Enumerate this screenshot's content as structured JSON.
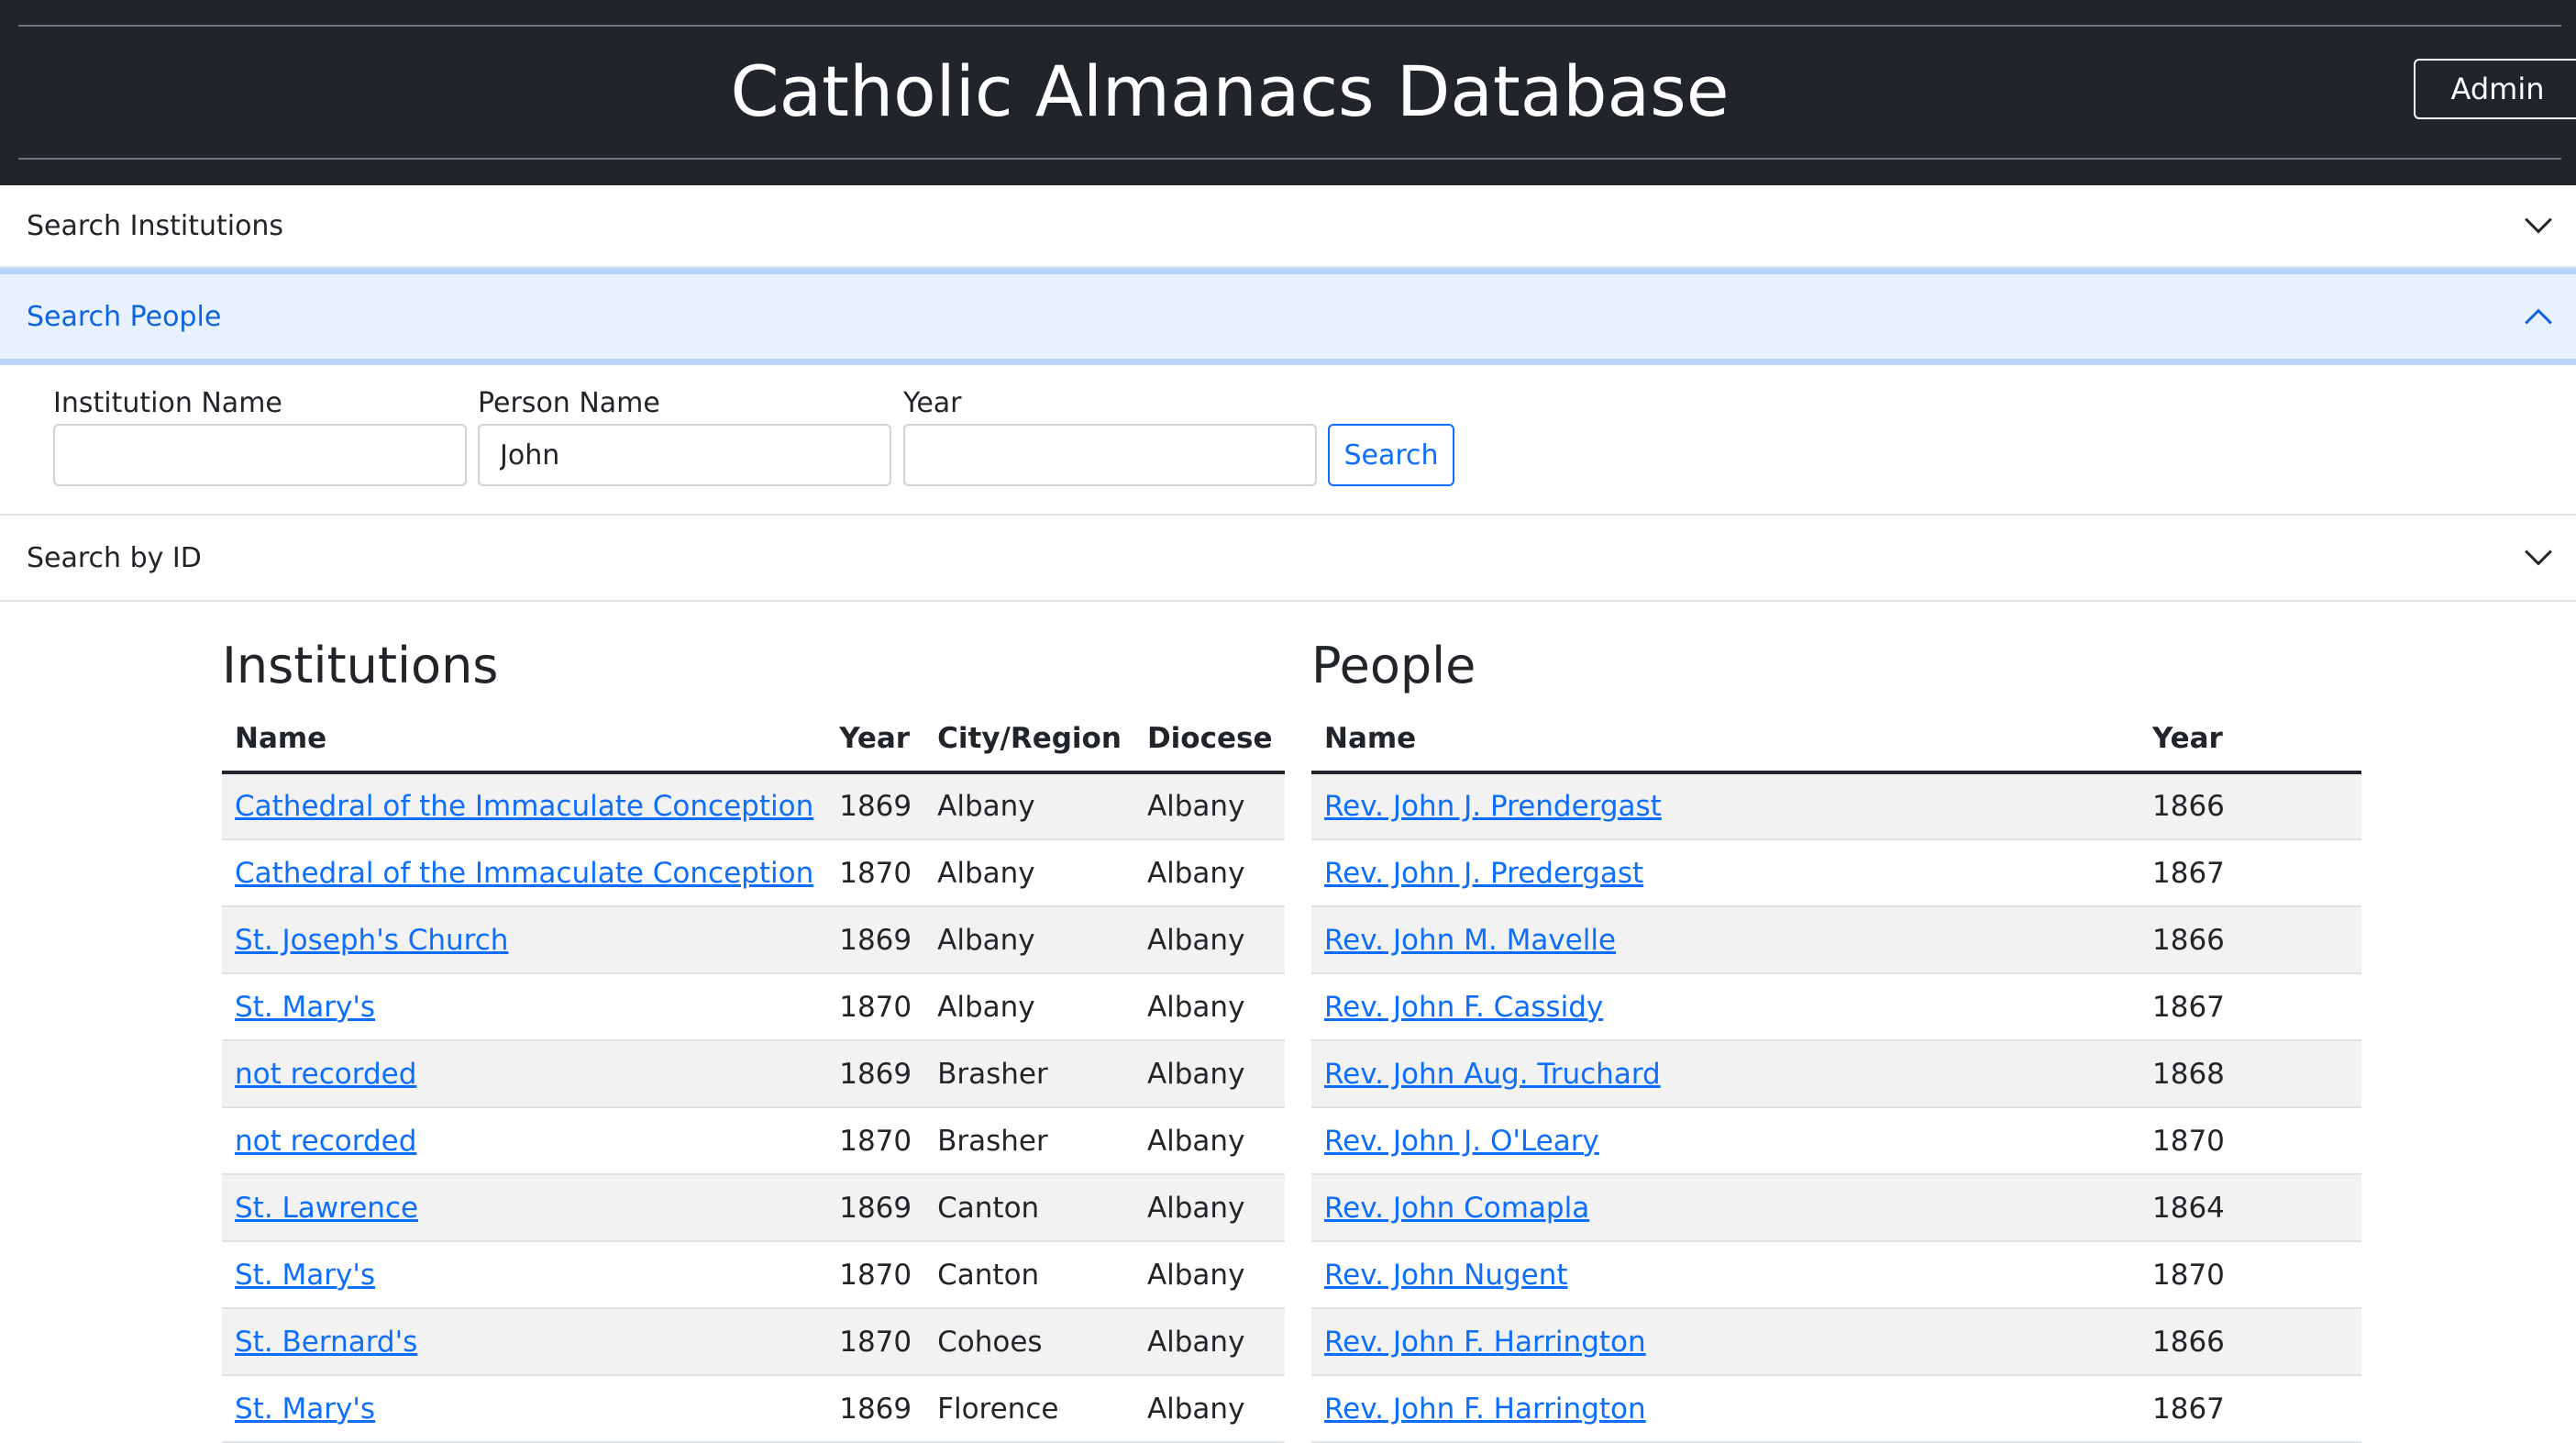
{
  "header": {
    "title": "Catholic Almanacs Database",
    "admin_label": "Admin"
  },
  "accordion": {
    "institutions_label": "Search Institutions",
    "people_label": "Search People",
    "id_label": "Search by ID"
  },
  "people_form": {
    "institution_label": "Institution Name",
    "institution_value": "",
    "person_label": "Person Name",
    "person_value": "John",
    "year_label": "Year",
    "year_value": "",
    "search_label": "Search"
  },
  "institutions": {
    "title": "Institutions",
    "columns": [
      "Name",
      "Year",
      "City/Region",
      "Diocese"
    ],
    "rows": [
      [
        "Cathedral of the Immaculate Conception",
        "1869",
        "Albany",
        "Albany"
      ],
      [
        "Cathedral of the Immaculate Conception",
        "1870",
        "Albany",
        "Albany"
      ],
      [
        "St. Joseph's Church",
        "1869",
        "Albany",
        "Albany"
      ],
      [
        "St. Mary's",
        "1870",
        "Albany",
        "Albany"
      ],
      [
        "not recorded",
        "1869",
        "Brasher",
        "Albany"
      ],
      [
        "not recorded",
        "1870",
        "Brasher",
        "Albany"
      ],
      [
        "St. Lawrence",
        "1869",
        "Canton",
        "Albany"
      ],
      [
        "St. Mary's",
        "1870",
        "Canton",
        "Albany"
      ],
      [
        "St. Bernard's",
        "1870",
        "Cohoes",
        "Albany"
      ],
      [
        "St. Mary's",
        "1869",
        "Florence",
        "Albany"
      ]
    ]
  },
  "people": {
    "title": "People",
    "columns": [
      "Name",
      "Year"
    ],
    "rows": [
      [
        "Rev. John J. Prendergast",
        "1866"
      ],
      [
        "Rev. John J. Predergast",
        "1867"
      ],
      [
        "Rev. John M. Mavelle",
        "1866"
      ],
      [
        "Rev. John F. Cassidy",
        "1867"
      ],
      [
        "Rev. John Aug. Truchard",
        "1868"
      ],
      [
        "Rev. John J. O'Leary",
        "1870"
      ],
      [
        "Rev. John Comapla",
        "1864"
      ],
      [
        "Rev. John Nugent",
        "1870"
      ],
      [
        "Rev. John F. Harrington",
        "1866"
      ],
      [
        "Rev. John F. Harrington",
        "1867"
      ]
    ]
  },
  "icons": {
    "accordion_collapsed": "chevron-down-icon",
    "accordion_expanded": "chevron-up-icon"
  }
}
